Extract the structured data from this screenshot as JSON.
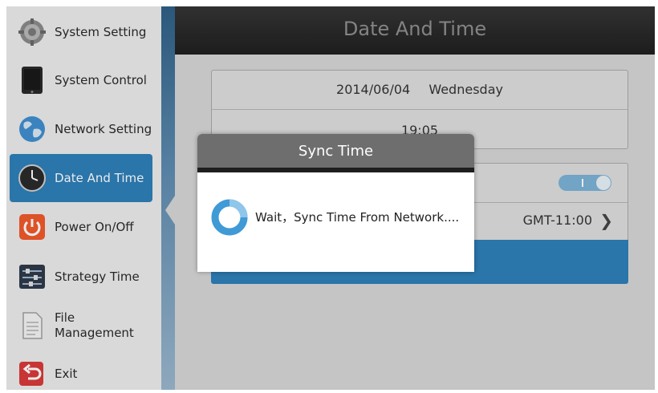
{
  "sidebar": {
    "items": [
      {
        "label": "System Setting",
        "icon": "gear-icon"
      },
      {
        "label": "System Control",
        "icon": "tablet-icon"
      },
      {
        "label": "Network Setting",
        "icon": "globe-icon"
      },
      {
        "label": "Date And Time",
        "icon": "clock-icon",
        "active": true
      },
      {
        "label": "Power On/Off",
        "icon": "power-icon"
      },
      {
        "label": "Strategy Time",
        "icon": "sliders-icon"
      },
      {
        "label": "File\nManagement",
        "icon": "document-icon"
      },
      {
        "label": "Exit",
        "icon": "exit-icon"
      }
    ]
  },
  "header": {
    "title": "Date And Time"
  },
  "datetime": {
    "date": "2014/06/04",
    "weekday": "Wednesday",
    "time": "19:05"
  },
  "settings": {
    "timezone": "GMT-11:00",
    "sync_toggle_on": true
  },
  "dialog": {
    "title": "Sync Time",
    "message": "Wait，Sync Time From Network...."
  },
  "colors": {
    "accent": "#2e7fb8",
    "header_bg": "#2a2a2a",
    "dialog_header": "#6e6e6e",
    "power_orange": "#f0592a",
    "exit_red": "#d93a3a"
  }
}
